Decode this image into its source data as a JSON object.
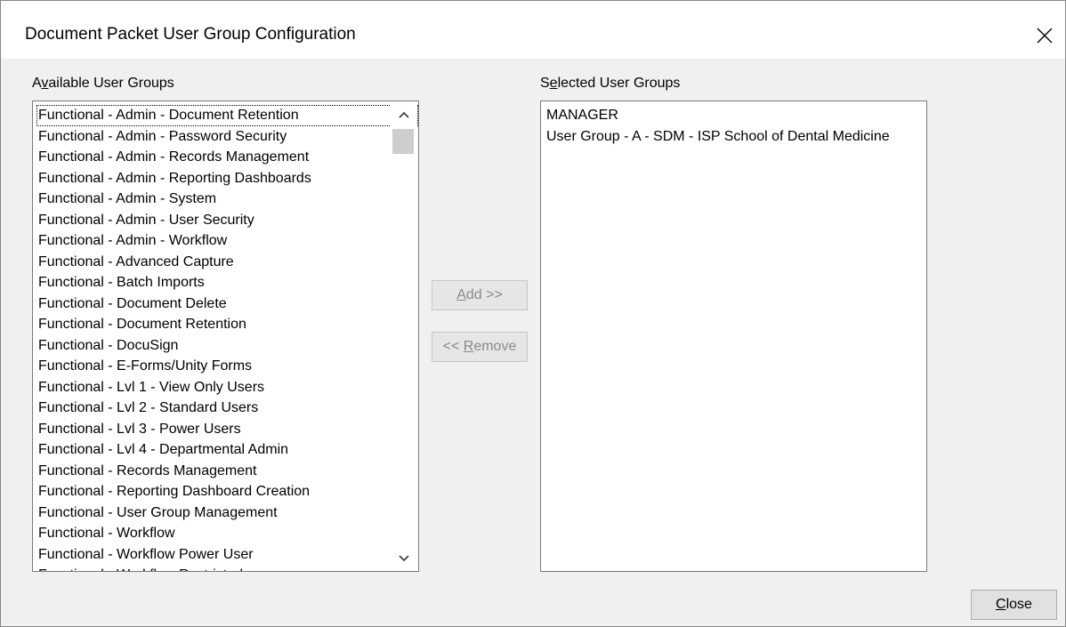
{
  "window": {
    "title": "Document Packet User Group Configuration",
    "close_glyph": "✕"
  },
  "available": {
    "label_prefix": "A",
    "label_mnemonic": "v",
    "label_suffix": "ailable User Groups",
    "items": [
      "Functional - Admin - Document Retention",
      "Functional - Admin - Password Security",
      "Functional - Admin - Records Management",
      "Functional - Admin - Reporting Dashboards",
      "Functional - Admin - System",
      "Functional - Admin - User Security",
      "Functional - Admin - Workflow",
      "Functional - Advanced Capture",
      "Functional - Batch Imports",
      "Functional - Document Delete",
      "Functional - Document Retention",
      "Functional - DocuSign",
      "Functional - E-Forms/Unity Forms",
      "Functional - Lvl 1 - View Only Users",
      "Functional - Lvl 2 - Standard Users",
      "Functional - Lvl 3 - Power Users",
      "Functional - Lvl 4 - Departmental Admin",
      "Functional - Records Management",
      "Functional - Reporting Dashboard Creation",
      "Functional - User Group Management",
      "Functional - Workflow",
      "Functional - Workflow Power User",
      "Functional - Workflow Restricted"
    ]
  },
  "selected": {
    "label_prefix": "S",
    "label_mnemonic": "e",
    "label_suffix": "lected User Groups",
    "items": [
      "MANAGER",
      "User Group - A - SDM - ISP School of Dental Medicine"
    ]
  },
  "buttons": {
    "add_prefix": "",
    "add_mnemonic": "A",
    "add_suffix": "dd >>",
    "remove_prefix": "<< ",
    "remove_mnemonic": "R",
    "remove_suffix": "emove",
    "close_prefix": "",
    "close_mnemonic": "C",
    "close_suffix": "lose"
  },
  "colors": {
    "dialog_bg": "#f0f0f0",
    "disabled_text": "#8a8a8a"
  },
  "icons": {
    "close": "close-icon",
    "scroll_up": "chevron-up-icon",
    "scroll_down": "chevron-down-icon"
  }
}
